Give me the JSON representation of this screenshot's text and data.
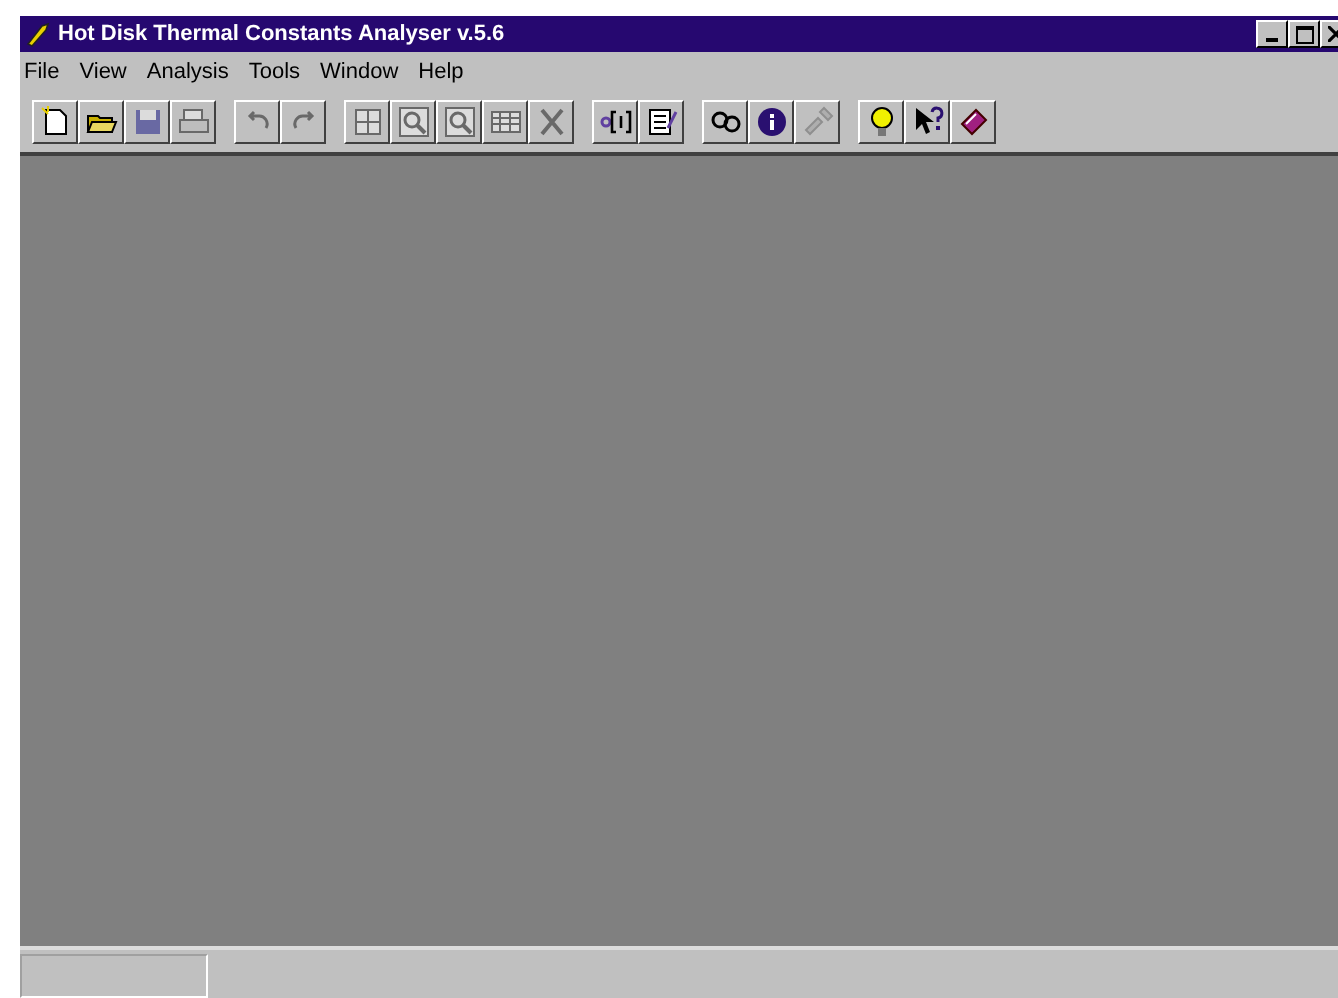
{
  "window": {
    "title": "Hot Disk Thermal Constants Analyser v.5.6"
  },
  "menu": [
    {
      "label": "File"
    },
    {
      "label": "View"
    },
    {
      "label": "Analysis"
    },
    {
      "label": "Tools"
    },
    {
      "label": "Window"
    },
    {
      "label": "Help"
    }
  ],
  "toolbar": [
    [
      {
        "kind": "new",
        "disabled": false
      },
      {
        "kind": "open",
        "disabled": false
      },
      {
        "kind": "save",
        "disabled": true
      },
      {
        "kind": "print",
        "disabled": true
      }
    ],
    [
      {
        "kind": "undo",
        "disabled": true
      },
      {
        "kind": "redo",
        "disabled": true
      }
    ],
    [
      {
        "kind": "grid",
        "disabled": true
      },
      {
        "kind": "zoom",
        "disabled": true
      },
      {
        "kind": "zoom",
        "disabled": true
      },
      {
        "kind": "table",
        "disabled": true
      },
      {
        "kind": "cut",
        "disabled": true
      }
    ],
    [
      {
        "kind": "io",
        "disabled": false
      },
      {
        "kind": "notes",
        "disabled": false
      }
    ],
    [
      {
        "kind": "link",
        "disabled": false
      },
      {
        "kind": "info",
        "disabled": false
      },
      {
        "kind": "tools",
        "disabled": true
      }
    ],
    [
      {
        "kind": "bulb",
        "disabled": false
      },
      {
        "kind": "help",
        "disabled": false
      },
      {
        "kind": "book",
        "disabled": false
      }
    ]
  ]
}
